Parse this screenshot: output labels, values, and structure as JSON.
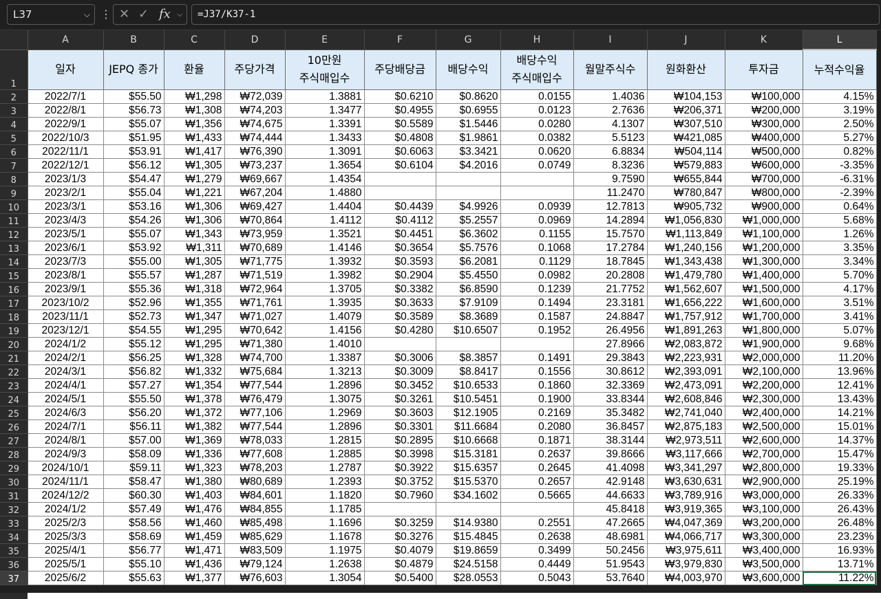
{
  "formula_bar": {
    "name_box": "L37",
    "fx_label": "fx",
    "formula": "=J37/K37-1"
  },
  "columns": [
    "A",
    "B",
    "C",
    "D",
    "E",
    "F",
    "G",
    "H",
    "I",
    "J",
    "K",
    "L"
  ],
  "header": [
    "일자",
    "JEPQ 종가",
    "환율",
    "주당가격",
    "10만원\n주식매입수",
    "주당배당금",
    "배당수익",
    "배당수익\n주식매입수",
    "월말주식수",
    "원화환산",
    "투자금",
    "누적수익율"
  ],
  "rows": [
    [
      "2022/7/1",
      "$55.50",
      "₩1,298",
      "₩72,039",
      "1.3881",
      "$0.6210",
      "$0.8620",
      "0.0155",
      "1.4036",
      "₩104,153",
      "₩100,000",
      "4.15%"
    ],
    [
      "2022/8/1",
      "$56.73",
      "₩1,308",
      "₩74,203",
      "1.3477",
      "$0.4955",
      "$0.6955",
      "0.0123",
      "2.7636",
      "₩206,371",
      "₩200,000",
      "3.19%"
    ],
    [
      "2022/9/1",
      "$55.07",
      "₩1,356",
      "₩74,675",
      "1.3391",
      "$0.5589",
      "$1.5446",
      "0.0280",
      "4.1307",
      "₩307,510",
      "₩300,000",
      "2.50%"
    ],
    [
      "2022/10/3",
      "$51.95",
      "₩1,433",
      "₩74,444",
      "1.3433",
      "$0.4808",
      "$1.9861",
      "0.0382",
      "5.5123",
      "₩421,085",
      "₩400,000",
      "5.27%"
    ],
    [
      "2022/11/1",
      "$53.91",
      "₩1,417",
      "₩76,390",
      "1.3091",
      "$0.6063",
      "$3.3421",
      "0.0620",
      "6.8834",
      "₩504,114",
      "₩500,000",
      "0.82%"
    ],
    [
      "2022/12/1",
      "$56.12",
      "₩1,305",
      "₩73,237",
      "1.3654",
      "$0.6104",
      "$4.2016",
      "0.0749",
      "8.3236",
      "₩579,883",
      "₩600,000",
      "-3.35%"
    ],
    [
      "2023/1/3",
      "$54.47",
      "₩1,279",
      "₩69,667",
      "1.4354",
      "",
      "",
      "",
      "9.7590",
      "₩655,844",
      "₩700,000",
      "-6.31%"
    ],
    [
      "2023/2/1",
      "$55.04",
      "₩1,221",
      "₩67,204",
      "1.4880",
      "",
      "",
      "",
      "11.2470",
      "₩780,847",
      "₩800,000",
      "-2.39%"
    ],
    [
      "2023/3/1",
      "$53.16",
      "₩1,306",
      "₩69,427",
      "1.4404",
      "$0.4439",
      "$4.9926",
      "0.0939",
      "12.7813",
      "₩905,732",
      "₩900,000",
      "0.64%"
    ],
    [
      "2023/4/3",
      "$54.26",
      "₩1,306",
      "₩70,864",
      "1.4112",
      "$0.4112",
      "$5.2557",
      "0.0969",
      "14.2894",
      "₩1,056,830",
      "₩1,000,000",
      "5.68%"
    ],
    [
      "2023/5/1",
      "$55.07",
      "₩1,343",
      "₩73,959",
      "1.3521",
      "$0.4451",
      "$6.3602",
      "0.1155",
      "15.7570",
      "₩1,113,849",
      "₩1,100,000",
      "1.26%"
    ],
    [
      "2023/6/1",
      "$53.92",
      "₩1,311",
      "₩70,689",
      "1.4146",
      "$0.3654",
      "$5.7576",
      "0.1068",
      "17.2784",
      "₩1,240,156",
      "₩1,200,000",
      "3.35%"
    ],
    [
      "2023/7/3",
      "$55.00",
      "₩1,305",
      "₩71,775",
      "1.3932",
      "$0.3593",
      "$6.2081",
      "0.1129",
      "18.7845",
      "₩1,343,438",
      "₩1,300,000",
      "3.34%"
    ],
    [
      "2023/8/1",
      "$55.57",
      "₩1,287",
      "₩71,519",
      "1.3982",
      "$0.2904",
      "$5.4550",
      "0.0982",
      "20.2808",
      "₩1,479,780",
      "₩1,400,000",
      "5.70%"
    ],
    [
      "2023/9/1",
      "$55.36",
      "₩1,318",
      "₩72,964",
      "1.3705",
      "$0.3382",
      "$6.8590",
      "0.1239",
      "21.7752",
      "₩1,562,607",
      "₩1,500,000",
      "4.17%"
    ],
    [
      "2023/10/2",
      "$52.96",
      "₩1,355",
      "₩71,761",
      "1.3935",
      "$0.3633",
      "$7.9109",
      "0.1494",
      "23.3181",
      "₩1,656,222",
      "₩1,600,000",
      "3.51%"
    ],
    [
      "2023/11/1",
      "$52.73",
      "₩1,347",
      "₩71,027",
      "1.4079",
      "$0.3589",
      "$8.3689",
      "0.1587",
      "24.8847",
      "₩1,757,912",
      "₩1,700,000",
      "3.41%"
    ],
    [
      "2023/12/1",
      "$54.55",
      "₩1,295",
      "₩70,642",
      "1.4156",
      "$0.4280",
      "$10.6507",
      "0.1952",
      "26.4956",
      "₩1,891,263",
      "₩1,800,000",
      "5.07%"
    ],
    [
      "2024/1/2",
      "$55.12",
      "₩1,295",
      "₩71,380",
      "1.4010",
      "",
      "",
      "",
      "27.8966",
      "₩2,083,872",
      "₩1,900,000",
      "9.68%"
    ],
    [
      "2024/2/1",
      "$56.25",
      "₩1,328",
      "₩74,700",
      "1.3387",
      "$0.3006",
      "$8.3857",
      "0.1491",
      "29.3843",
      "₩2,223,931",
      "₩2,000,000",
      "11.20%"
    ],
    [
      "2024/3/1",
      "$56.82",
      "₩1,332",
      "₩75,684",
      "1.3213",
      "$0.3009",
      "$8.8417",
      "0.1556",
      "30.8612",
      "₩2,393,091",
      "₩2,100,000",
      "13.96%"
    ],
    [
      "2024/4/1",
      "$57.27",
      "₩1,354",
      "₩77,544",
      "1.2896",
      "$0.3452",
      "$10.6533",
      "0.1860",
      "32.3369",
      "₩2,473,091",
      "₩2,200,000",
      "12.41%"
    ],
    [
      "2024/5/1",
      "$55.50",
      "₩1,378",
      "₩76,479",
      "1.3075",
      "$0.3261",
      "$10.5451",
      "0.1900",
      "33.8344",
      "₩2,608,846",
      "₩2,300,000",
      "13.43%"
    ],
    [
      "2024/6/3",
      "$56.20",
      "₩1,372",
      "₩77,106",
      "1.2969",
      "$0.3603",
      "$12.1905",
      "0.2169",
      "35.3482",
      "₩2,741,040",
      "₩2,400,000",
      "14.21%"
    ],
    [
      "2024/7/1",
      "$56.11",
      "₩1,382",
      "₩77,544",
      "1.2896",
      "$0.3301",
      "$11.6684",
      "0.2080",
      "36.8457",
      "₩2,875,183",
      "₩2,500,000",
      "15.01%"
    ],
    [
      "2024/8/1",
      "$57.00",
      "₩1,369",
      "₩78,033",
      "1.2815",
      "$0.2895",
      "$10.6668",
      "0.1871",
      "38.3144",
      "₩2,973,511",
      "₩2,600,000",
      "14.37%"
    ],
    [
      "2024/9/3",
      "$58.09",
      "₩1,336",
      "₩77,608",
      "1.2885",
      "$0.3998",
      "$15.3181",
      "0.2637",
      "39.8666",
      "₩3,117,666",
      "₩2,700,000",
      "15.47%"
    ],
    [
      "2024/10/1",
      "$59.11",
      "₩1,323",
      "₩78,203",
      "1.2787",
      "$0.3922",
      "$15.6357",
      "0.2645",
      "41.4098",
      "₩3,341,297",
      "₩2,800,000",
      "19.33%"
    ],
    [
      "2024/11/1",
      "$58.47",
      "₩1,380",
      "₩80,689",
      "1.2393",
      "$0.3752",
      "$15.5370",
      "0.2657",
      "42.9148",
      "₩3,630,631",
      "₩2,900,000",
      "25.19%"
    ],
    [
      "2024/12/2",
      "$60.30",
      "₩1,403",
      "₩84,601",
      "1.1820",
      "$0.7960",
      "$34.1602",
      "0.5665",
      "44.6633",
      "₩3,789,916",
      "₩3,000,000",
      "26.33%"
    ],
    [
      "2024/1/2",
      "$57.49",
      "₩1,476",
      "₩84,855",
      "1.1785",
      "",
      "",
      "",
      "45.8418",
      "₩3,919,365",
      "₩3,100,000",
      "26.43%"
    ],
    [
      "2025/2/3",
      "$58.56",
      "₩1,460",
      "₩85,498",
      "1.1696",
      "$0.3259",
      "$14.9380",
      "0.2551",
      "47.2665",
      "₩4,047,369",
      "₩3,200,000",
      "26.48%"
    ],
    [
      "2025/3/3",
      "$58.69",
      "₩1,459",
      "₩85,629",
      "1.1678",
      "$0.3276",
      "$15.4845",
      "0.2638",
      "48.6981",
      "₩4,066,717",
      "₩3,300,000",
      "23.23%"
    ],
    [
      "2025/4/1",
      "$56.77",
      "₩1,471",
      "₩83,509",
      "1.1975",
      "$0.4079",
      "$19.8659",
      "0.3499",
      "50.2456",
      "₩3,975,611",
      "₩3,400,000",
      "16.93%"
    ],
    [
      "2025/5/1",
      "$55.10",
      "₩1,436",
      "₩79,124",
      "1.2638",
      "$0.4879",
      "$24.5158",
      "0.4449",
      "51.9543",
      "₩3,979,830",
      "₩3,500,000",
      "13.71%"
    ],
    [
      "2025/6/2",
      "$55.63",
      "₩1,377",
      "₩76,603",
      "1.3054",
      "$0.5400",
      "$28.0553",
      "0.5043",
      "53.7640",
      "₩4,003,970",
      "₩3,600,000",
      "11.22%"
    ]
  ],
  "selection": {
    "column": "L",
    "row": 37
  },
  "colors": {
    "header_fill": "#dcebf7",
    "selection_border": "#1e7145",
    "chrome": "#1f1f1f"
  },
  "icons": [
    "chevron-down-icon",
    "more-icon",
    "cancel-icon",
    "confirm-icon",
    "function-icon"
  ]
}
